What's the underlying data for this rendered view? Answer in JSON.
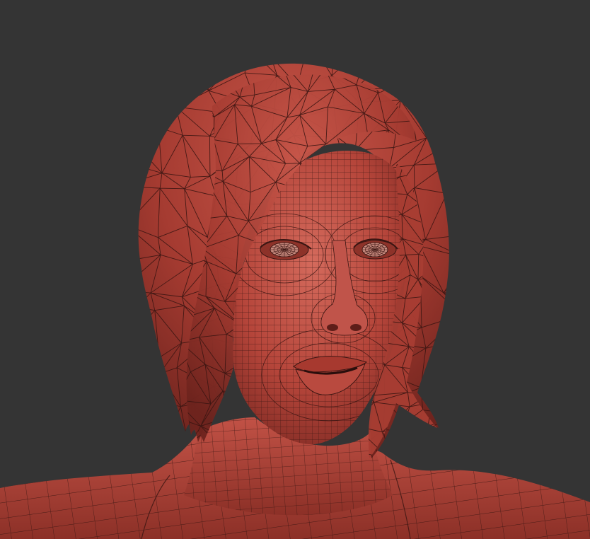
{
  "scene": {
    "subject": "wireframe-head-sculpt",
    "colors": {
      "background": "#343434",
      "clay": "#b5453a",
      "clay_light": "#d0665a",
      "clay_dark": "#7e2a23",
      "wire": "#3a1512",
      "eye": "#c88a7e"
    },
    "display": {
      "wireframe": true,
      "hair_topology": "triangulated",
      "body_topology": "quads"
    }
  }
}
